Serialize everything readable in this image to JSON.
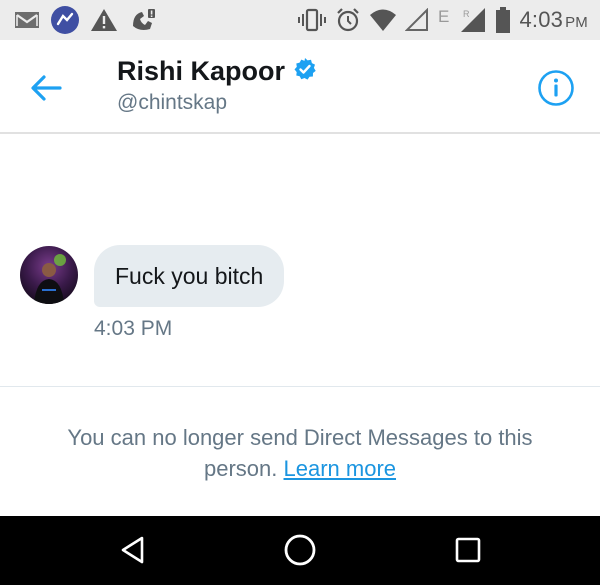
{
  "status_bar": {
    "time": "4:03",
    "ampm": "PM",
    "left_icons": [
      "gmail-icon",
      "app-notification-icon",
      "warning-icon",
      "missed-call-icon"
    ],
    "right_icons": [
      "vibrate-icon",
      "alarm-icon",
      "wifi-icon",
      "signal-empty-icon",
      "network-e-icon",
      "signal-roaming-icon",
      "battery-icon"
    ],
    "network_letter": "E",
    "roaming_letter": "R"
  },
  "header": {
    "name": "Rishi Kapoor",
    "handle": "@chintskap",
    "verified": true,
    "accent_color": "#1da1f2"
  },
  "conversation": {
    "messages": [
      {
        "text": "Fuck you bitch",
        "time": "4:03 PM"
      }
    ]
  },
  "notice": {
    "text": "You can no longer send Direct Messages to this person.",
    "link_text": "Learn more"
  },
  "nav_bar": {
    "icons": [
      "back-triangle-icon",
      "home-circle-icon",
      "recents-square-icon"
    ]
  }
}
